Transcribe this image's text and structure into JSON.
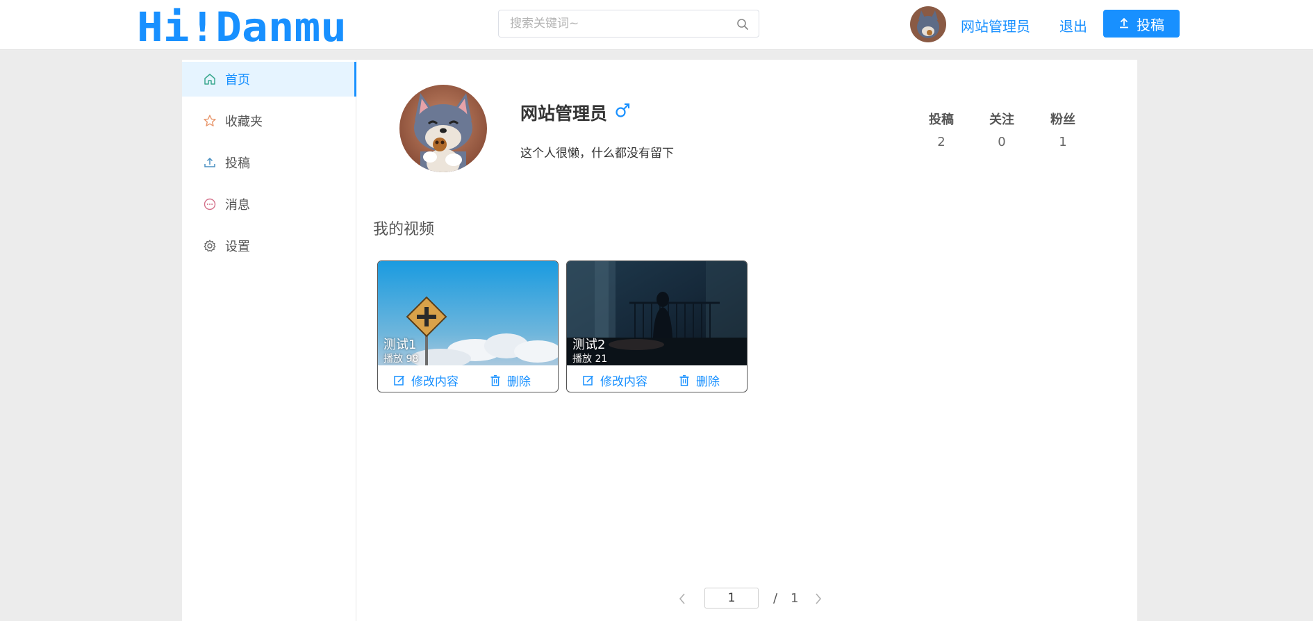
{
  "header": {
    "logo_text": "Hi!Danmu",
    "search_placeholder": "搜索关键词~",
    "username": "网站管理员",
    "logout": "退出",
    "upload_label": "投稿",
    "accent_color": "#1890ff"
  },
  "sidebar": {
    "items": [
      {
        "label": "首页",
        "icon": "home-icon",
        "active": true
      },
      {
        "label": "收藏夹",
        "icon": "star-icon",
        "active": false
      },
      {
        "label": "投稿",
        "icon": "upload-icon",
        "active": false
      },
      {
        "label": "消息",
        "icon": "message-icon",
        "active": false
      },
      {
        "label": "设置",
        "icon": "gear-icon",
        "active": false
      }
    ]
  },
  "profile": {
    "name": "网站管理员",
    "gender_icon": "male-icon",
    "bio": "这个人很懒，什么都没有留下",
    "stats": [
      {
        "label": "投稿",
        "value": "2"
      },
      {
        "label": "关注",
        "value": "0"
      },
      {
        "label": "粉丝",
        "value": "1"
      }
    ]
  },
  "videos": {
    "section_title": "我的视频",
    "items": [
      {
        "title": "测试1",
        "plays": "播放  98",
        "edit": "修改内容",
        "delete": "删除"
      },
      {
        "title": "测试2",
        "plays": "播放  21",
        "edit": "修改内容",
        "delete": "删除"
      }
    ]
  },
  "pagination": {
    "current": "1",
    "separator": "/",
    "total": "1"
  }
}
